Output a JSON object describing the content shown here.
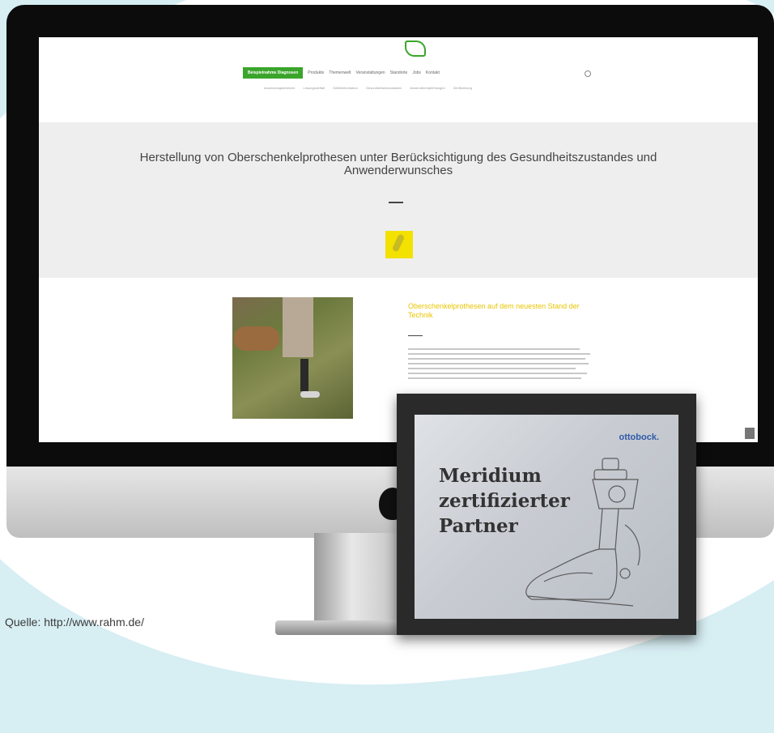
{
  "nav": {
    "green_items": [
      "Beispielnahme",
      "Diagnosen"
    ],
    "items": [
      "Produkte",
      "Themenwelt",
      "Veranstaltungen",
      "Standorte",
      "Jobs",
      "Kontakt"
    ]
  },
  "subnav": [
    "Anwendungsbereiche",
    "Lösungsvielfalt",
    "Gefäßinformation",
    "Gesundheitsbewusstsein",
    "Anwenderempfehlungen",
    "Zertifizierung"
  ],
  "hero": {
    "title": "Herstellung von Oberschenkelprothesen unter Berücksichtigung des Gesundheitszustandes und Anwenderwunsches"
  },
  "article": {
    "title": "Oberschenkelprothesen auf dem neuesten Stand der Technik"
  },
  "certificate": {
    "brand": "ottobock.",
    "line1": "Meridium",
    "line2": "zertifizierter",
    "line3": "Partner"
  },
  "source": "Quelle: http://www.rahm.de/",
  "colors": {
    "accent_green": "#3aa52a",
    "title_yellow": "#e8c500",
    "brand_blue": "#2f5aa8"
  }
}
